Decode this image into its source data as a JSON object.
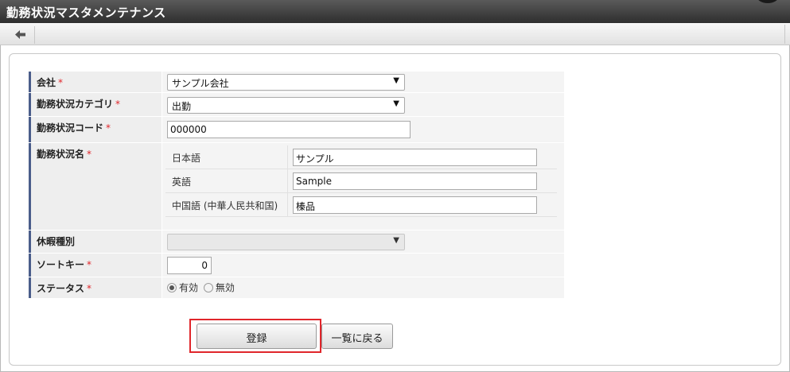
{
  "header": {
    "title": "勤務状況マスタメンテナンス"
  },
  "toolbar": {
    "back_icon": "arrow-left-icon"
  },
  "form": {
    "company": {
      "label": "会社",
      "required_mark": "*",
      "value": "サンプル会社"
    },
    "category": {
      "label": "勤務状況カテゴリ",
      "required_mark": "*",
      "value": "出勤"
    },
    "code": {
      "label": "勤務状況コード",
      "required_mark": "*",
      "value": "000000"
    },
    "name": {
      "label": "勤務状況名",
      "required_mark": "*",
      "locales": [
        {
          "label": "日本語",
          "value": "サンプル"
        },
        {
          "label": "英語",
          "value": "Sample"
        },
        {
          "label": "中国語 (中華人民共和国)",
          "value": "榛品"
        }
      ]
    },
    "leave_type": {
      "label": "休暇種別",
      "value": ""
    },
    "sort_key": {
      "label": "ソートキー",
      "required_mark": "*",
      "value": "0"
    },
    "status": {
      "label": "ステータス",
      "required_mark": "*",
      "options": [
        {
          "label": "有効",
          "checked": true
        },
        {
          "label": "無効",
          "checked": false
        }
      ]
    }
  },
  "actions": {
    "register_label": "登録",
    "back_label": "一覧に戻る"
  },
  "colors": {
    "highlight": "#e0262b",
    "label_accent": "#4a5d8a",
    "required": "#e0262b"
  }
}
